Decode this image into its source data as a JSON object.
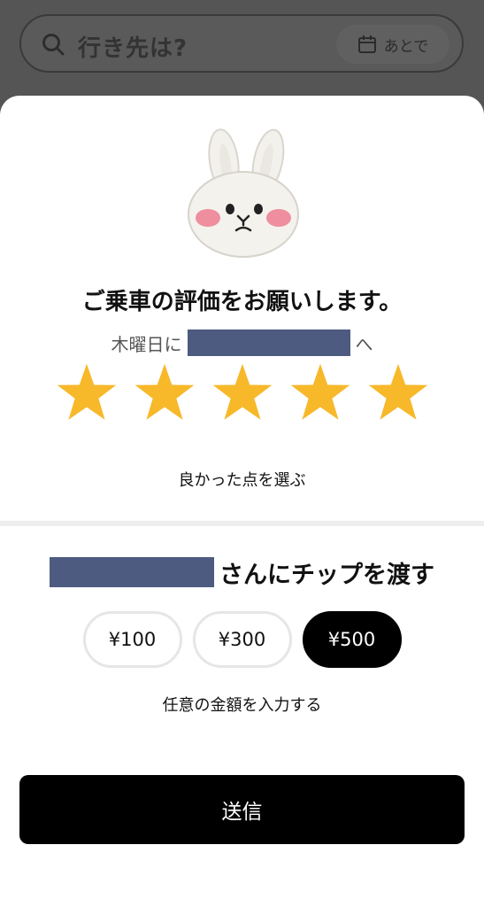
{
  "search": {
    "placeholder": "行き先は?",
    "later_label": "あとで"
  },
  "rating": {
    "title": "ご乗車の評価をお願いします。",
    "subtitle_prefix": "木曜日に",
    "subtitle_suffix": "へ",
    "stars_filled": 5,
    "stars_total": 5,
    "star_color": "#F7B82A",
    "select_good_points": "良かった点を選ぶ"
  },
  "tip": {
    "title_suffix": "さんにチップを渡す",
    "options": [
      {
        "label": "¥100",
        "selected": false
      },
      {
        "label": "¥300",
        "selected": false
      },
      {
        "label": "¥500",
        "selected": true
      }
    ],
    "custom_amount": "任意の金額を入力する"
  },
  "submit_label": "送信"
}
